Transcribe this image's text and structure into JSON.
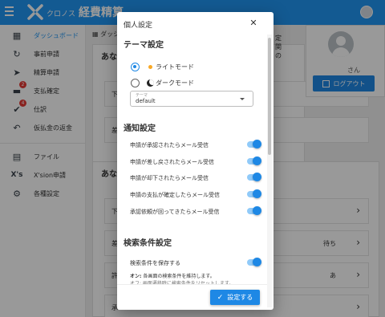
{
  "app": {
    "title_small": "クロノス",
    "title_main": "経費精算"
  },
  "sidebar": {
    "items": [
      {
        "label": "ダッシュボード",
        "icon": "dashboard-icon",
        "active": true
      },
      {
        "label": "事前申請",
        "icon": "pre-application-icon"
      },
      {
        "label": "精算申請",
        "icon": "send-icon"
      },
      {
        "label": "支払確定",
        "icon": "payment-icon",
        "badge": "2"
      },
      {
        "label": "仕訳",
        "icon": "checkmark-icon",
        "badge": "4"
      },
      {
        "label": "仮払金の返金",
        "icon": "undo-icon"
      },
      {
        "label": "ファイル",
        "icon": "file-icon"
      },
      {
        "label": "X'sion申請",
        "icon": "xsion-icon"
      },
      {
        "label": "各種設定",
        "icon": "gear-icon"
      }
    ]
  },
  "main": {
    "breadcrumb": "ダッシュ",
    "card1_title": "あな",
    "card2_title": "あな",
    "row_frags": [
      "下",
      "差",
      "下",
      "差",
      "許",
      "承"
    ],
    "right_frags": [
      "定",
      "関",
      "の"
    ],
    "extra1": "待ち",
    "extra2": "あ"
  },
  "user": {
    "name": "さん",
    "logout_label": "ログアウト"
  },
  "dialog": {
    "title": "個人設定",
    "theme_heading": "テーマ設定",
    "theme_options": [
      {
        "label": "ライトモード",
        "selected": true
      },
      {
        "label": "ダークモード",
        "selected": false
      }
    ],
    "theme_select_label": "テーマ",
    "theme_select_value": "default",
    "notification_heading": "通知設定",
    "notifications": [
      {
        "label": "申請が承認されたらメール受信",
        "on": true
      },
      {
        "label": "申請が差し戻されたらメール受信",
        "on": true
      },
      {
        "label": "申請が却下されたらメール受信",
        "on": true
      },
      {
        "label": "申請の支払が確定したらメール受信",
        "on": true
      },
      {
        "label": "承認依頼が回ってきたらメール受信",
        "on": true
      }
    ],
    "search_heading": "検索条件設定",
    "save_search_label": "検索条件を保存する",
    "save_search_on": true,
    "desc_on_prefix": "オン:",
    "desc_on_text": "各画面の検索条件を維持します。",
    "desc_off_text": "オフ: 画面遷移時に検索条件をリセットします。",
    "apply_label": "設定する"
  },
  "colors": {
    "primary": "#2196f3",
    "button": "#1e88e5",
    "badge": "#e53935",
    "toggle_track": "#90caf9"
  }
}
